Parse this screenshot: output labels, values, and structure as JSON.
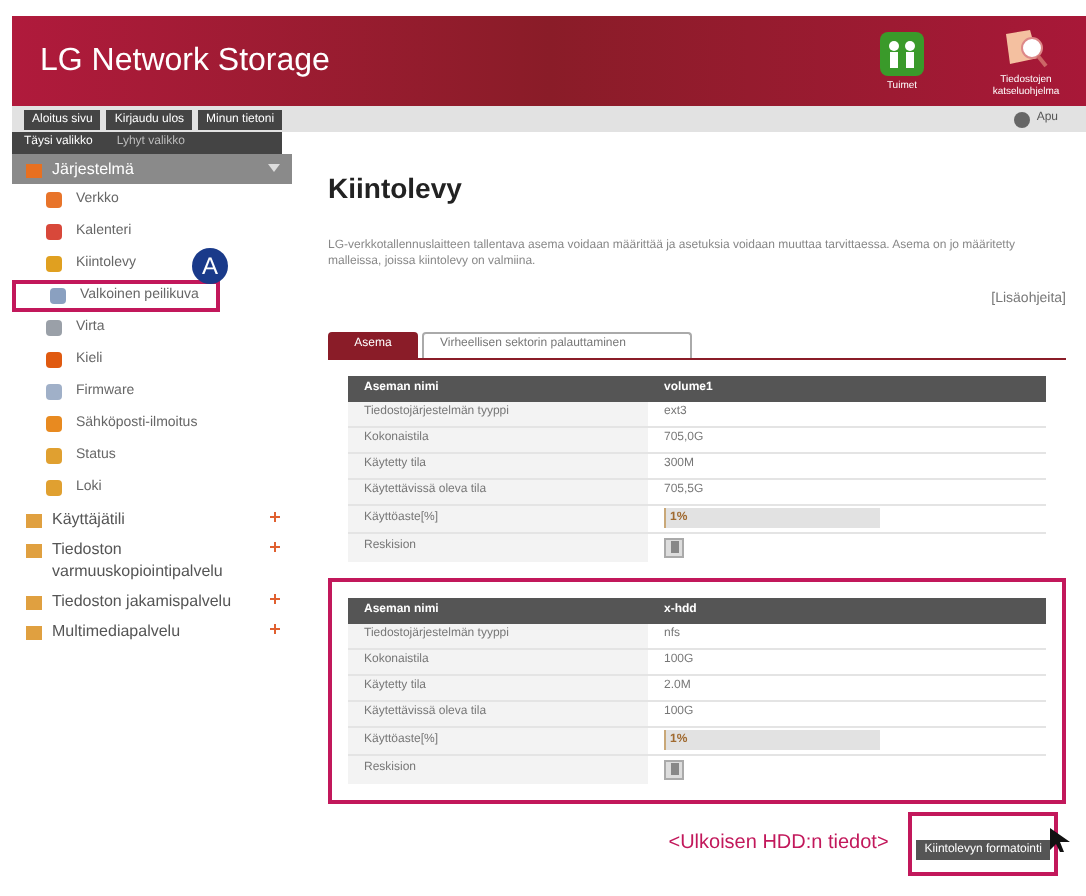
{
  "header": {
    "title": "LG Network Storage",
    "shortcuts": [
      "Tuimet",
      "Tiedostojen katseluohjelma"
    ]
  },
  "nav": {
    "buttons": [
      "Aloitus sivu",
      "Kirjaudu ulos",
      "Minun tietoni"
    ],
    "help": "Apu"
  },
  "menu_tabs": [
    {
      "label": "Täysi valikko",
      "selected": true
    },
    {
      "label": "Lyhyt valikko",
      "selected": false
    }
  ],
  "sidebar": [
    {
      "label": "Järjestelmä",
      "expanded": true,
      "children": [
        {
          "label": "Verkko",
          "highlighted": false
        },
        {
          "label": "Kalenteri",
          "highlighted": false
        },
        {
          "label": "Kiintolevy",
          "highlighted": false
        },
        {
          "label": "Valkoinen peilikuva",
          "highlighted": true
        },
        {
          "label": "Virta",
          "highlighted": false
        },
        {
          "label": "Kieli",
          "highlighted": false
        },
        {
          "label": "Firmware",
          "highlighted": false
        },
        {
          "label": "Sähköposti-ilmoitus",
          "highlighted": false
        },
        {
          "label": "Status",
          "highlighted": false
        },
        {
          "label": "Loki",
          "highlighted": false
        }
      ]
    },
    {
      "label": "Käyttäjätili",
      "expanded": false
    },
    {
      "label": "Tiedoston varmuuskopiointipalvelu",
      "expanded": false
    },
    {
      "label": "Tiedoston jakamispalvelu",
      "expanded": false
    },
    {
      "label": "Multimediapalvelu",
      "expanded": false
    }
  ],
  "badge": "A",
  "page": {
    "title": "Kiintolevy",
    "description": "LG-verkkotallennuslaitteen tallentava asema voidaan määrittää ja asetuksia voidaan muuttaa tarvittaessa. Asema on jo määritetty malleissa, joissa kiintolevy on valmiina.",
    "help_link": "[Lisäohjeita]",
    "tabs": [
      {
        "label": "Asema",
        "selected": true
      },
      {
        "label": "Virheellisen sektorin palauttaminen",
        "selected": false
      }
    ],
    "drives": [
      {
        "highlighted": false,
        "header": [
          "Aseman nimi",
          "volume1"
        ],
        "rows": [
          [
            "Tiedostojärjestelmän tyyppi",
            "ext3"
          ],
          [
            "Kokonaistila",
            "705,0G"
          ],
          [
            "Käytetty tila",
            "300M"
          ],
          [
            "Käytettävissä oleva tila",
            "705,5G"
          ]
        ],
        "usage_label": "Käyttöaste[%]",
        "usage": "1%",
        "level": 0.01,
        "remove_label": "Reskision"
      },
      {
        "highlighted": true,
        "header": [
          "Aseman nimi",
          "x-hdd"
        ],
        "rows": [
          [
            "Tiedostojärjestelmän tyyppi",
            "nfs"
          ],
          [
            "Kokonaistila",
            "100G"
          ],
          [
            "Käytetty tila",
            "2.0M"
          ],
          [
            "Käytettävissä oleva tila",
            "100G"
          ]
        ],
        "usage_label": "Käyttöaste[%]",
        "usage": "1%",
        "level": 0.01,
        "remove_label": "Reskision"
      }
    ],
    "caption": "<Ulkoisen HDD:n tiedot>",
    "format_button": "Kiintolevyn formatointi"
  }
}
